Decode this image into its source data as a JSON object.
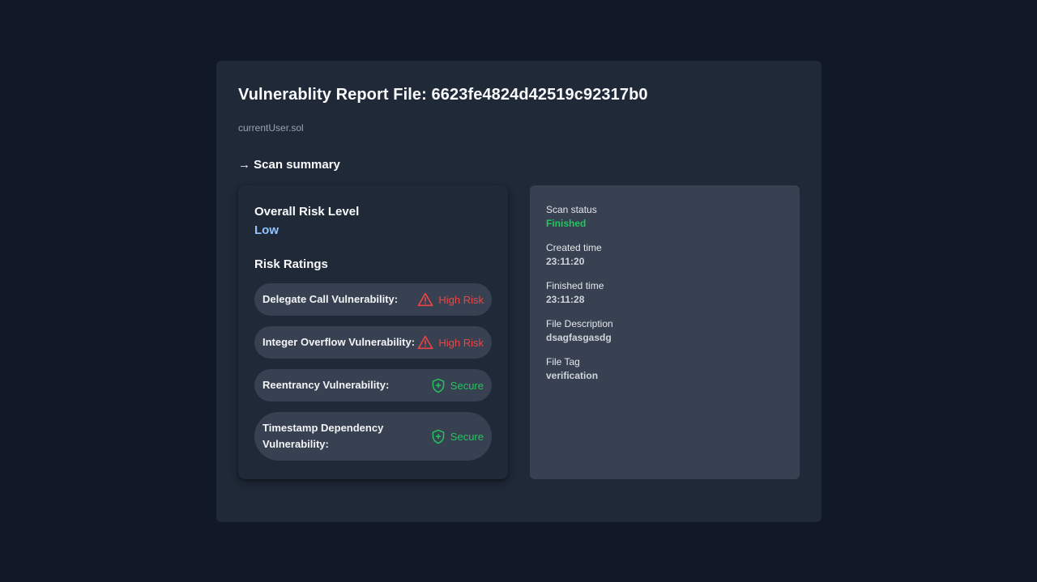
{
  "report": {
    "title": "Vulnerablity Report File: 6623fe4824d42519c92317b0",
    "file_name": "currentUser.sol",
    "section_heading": "→ Scan summary"
  },
  "risk": {
    "overall_label": "Overall Risk Level",
    "overall_value": "Low",
    "ratings_heading": "Risk Ratings",
    "ratings": [
      {
        "name": "Delegate Call Vulnerability:",
        "status": "High Risk",
        "icon": "warning-triangle-icon",
        "color": "#ef4444"
      },
      {
        "name": "Integer Overflow Vulnerability:",
        "status": "High Risk",
        "icon": "warning-triangle-icon",
        "color": "#ef4444"
      },
      {
        "name": "Reentrancy Vulnerability:",
        "status": "Secure",
        "icon": "shield-plus-icon",
        "color": "#22c55e"
      },
      {
        "name": "Timestamp Dependency Vulnerability:",
        "status": "Secure",
        "icon": "shield-plus-icon",
        "color": "#22c55e"
      }
    ]
  },
  "details": {
    "scan_status_label": "Scan status",
    "scan_status_value": "Finished",
    "created_label": "Created time",
    "created_value": "23:11:20",
    "finished_label": "Finished time",
    "finished_value": "23:11:28",
    "description_label": "File Description",
    "description_value": "dsagfasgasdg",
    "tag_label": "File Tag",
    "tag_value": "verification"
  },
  "colors": {
    "background": "#111827",
    "card": "#1f2937",
    "pill": "#374151",
    "accent_blue": "#93c5fd",
    "danger": "#ef4444",
    "success": "#22c55e"
  }
}
